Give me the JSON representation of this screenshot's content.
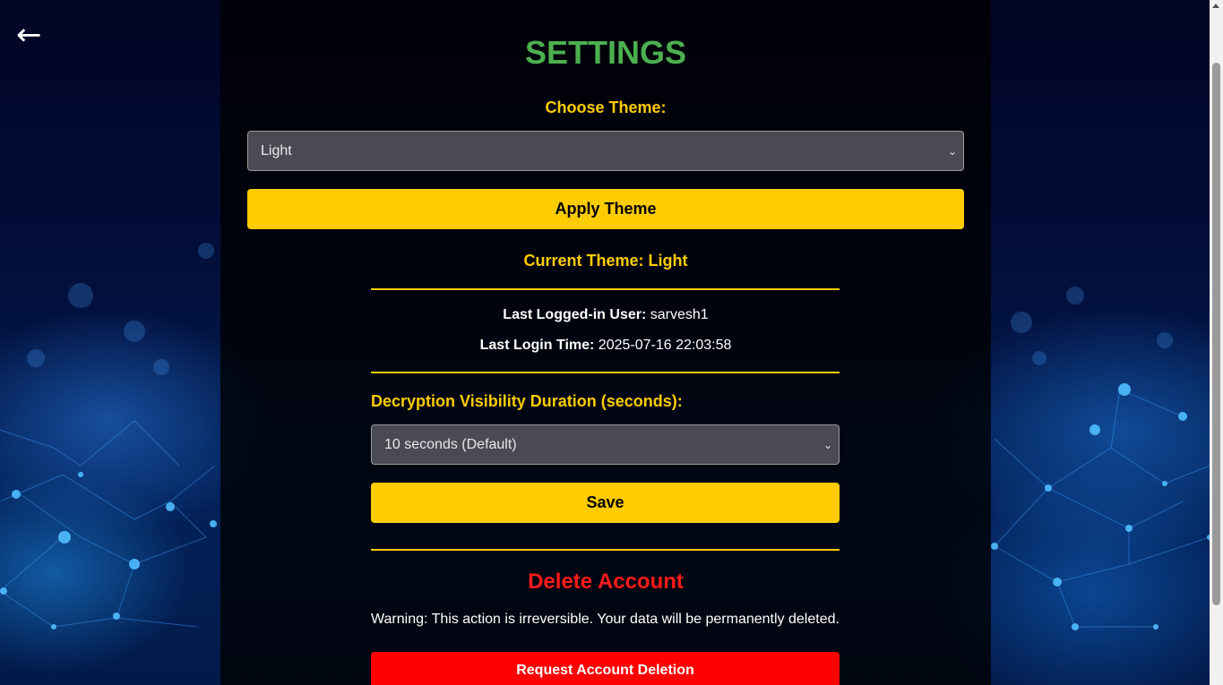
{
  "nav": {
    "back_icon": "←"
  },
  "settings": {
    "title": "SETTINGS",
    "choose_theme_label": "Choose Theme:",
    "theme_select_value": "Light",
    "apply_theme_label": "Apply Theme",
    "current_theme_text": "Current Theme: Light",
    "last_user_label": "Last Logged-in User:",
    "last_user_value": "sarvesh1",
    "last_login_label": "Last Login Time:",
    "last_login_value": "2025-07-16 22:03:58",
    "decrypt_label": "Decryption Visibility Duration (seconds):",
    "decrypt_select_value": "10 seconds (Default)",
    "save_label": "Save",
    "delete_title": "Delete Account",
    "delete_warning": "Warning: This action is irreversible. Your data will be permanently deleted.",
    "delete_button_label": "Request Account Deletion"
  },
  "colors": {
    "accent_yellow": "#ffcc00",
    "title_green": "#4caf50",
    "danger_red": "#ff0000"
  },
  "icons": [
    "back-arrow-icon",
    "chevron-down-icon"
  ]
}
